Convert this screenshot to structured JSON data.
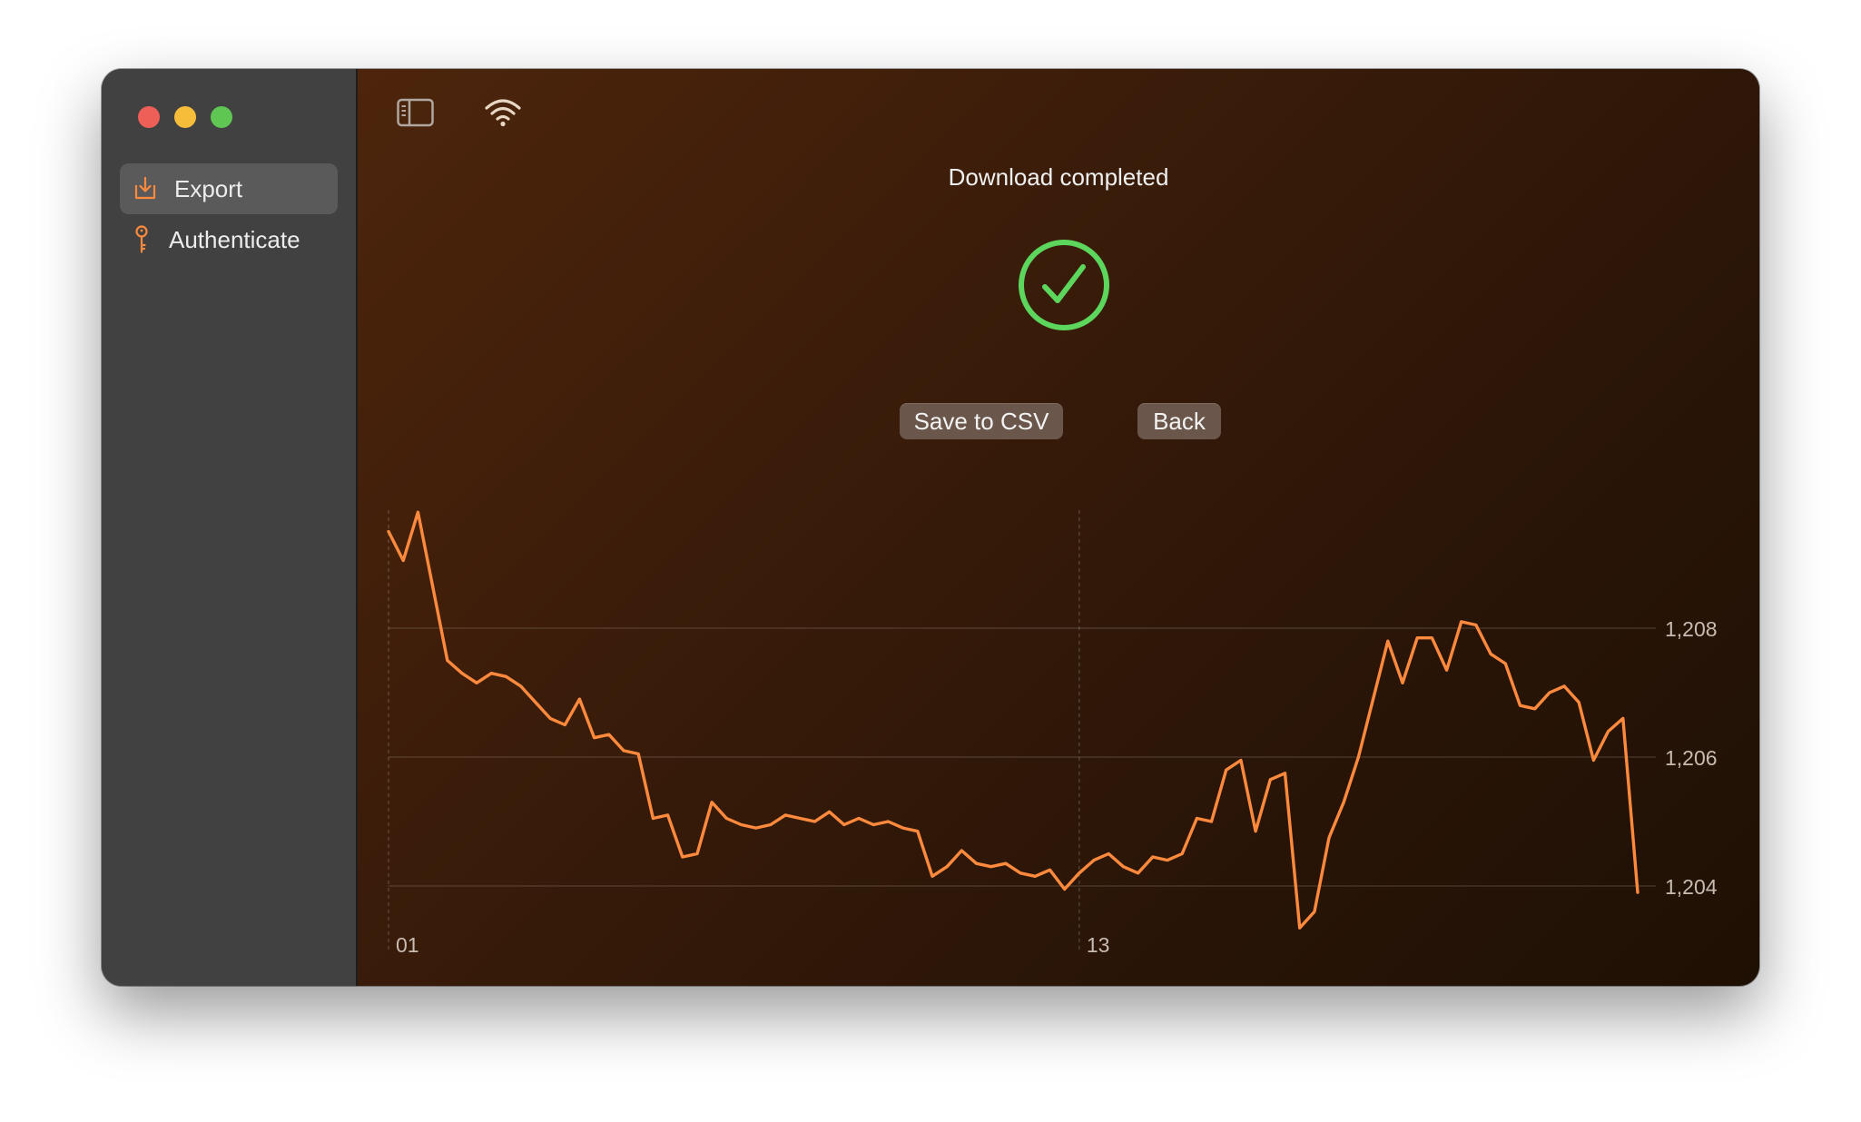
{
  "sidebar": {
    "items": [
      {
        "label": "Export",
        "icon": "download-tray-icon",
        "selected": true
      },
      {
        "label": "Authenticate",
        "icon": "key-icon",
        "selected": false
      }
    ]
  },
  "toolbar": {
    "icons": [
      "sidebar-toggle-icon",
      "wifi-icon"
    ]
  },
  "main": {
    "status": "Download completed",
    "status_icon": "checkmark-circle-icon",
    "status_color": "#5cd65c",
    "buttons": {
      "save_label": "Save to CSV",
      "back_label": "Back"
    }
  },
  "colors": {
    "accent": "#ff8a3d",
    "line": "#ff8a3d"
  },
  "chart_data": {
    "type": "line",
    "title": "",
    "xlabel": "",
    "ylabel": "",
    "x_tick_labels": [
      "01",
      "13",
      "01"
    ],
    "x_tick_index": [
      0,
      47,
      94
    ],
    "y_ticks": [
      1204,
      1206,
      1208
    ],
    "y_tick_labels": [
      "1,204",
      "1,206",
      "1,208"
    ],
    "ylim": [
      1203.0,
      1210.0
    ],
    "y_axis_position": "right",
    "grid": true,
    "series": [
      {
        "values": [
          1209.5,
          1209.05,
          1209.8,
          1208.65,
          1207.5,
          1207.3,
          1207.15,
          1207.3,
          1207.25,
          1207.1,
          1206.85,
          1206.6,
          1206.5,
          1206.9,
          1206.3,
          1206.35,
          1206.1,
          1206.05,
          1205.05,
          1205.1,
          1204.45,
          1204.5,
          1205.3,
          1205.05,
          1204.95,
          1204.9,
          1204.95,
          1205.1,
          1205.05,
          1205.0,
          1205.15,
          1204.95,
          1205.05,
          1204.95,
          1205.0,
          1204.9,
          1204.85,
          1204.15,
          1204.3,
          1204.55,
          1204.35,
          1204.3,
          1204.35,
          1204.2,
          1204.15,
          1204.25,
          1203.95,
          1204.2,
          1204.4,
          1204.5,
          1204.3,
          1204.2,
          1204.45,
          1204.4,
          1204.5,
          1205.05,
          1205.0,
          1205.8,
          1205.95,
          1204.85,
          1205.65,
          1205.75,
          1203.35,
          1203.6,
          1204.75,
          1205.3,
          1206.0,
          1206.9,
          1207.8,
          1207.15,
          1207.85,
          1207.85,
          1207.35,
          1208.1,
          1208.05,
          1207.6,
          1207.45,
          1206.8,
          1206.75,
          1207.0,
          1207.1,
          1206.85,
          1205.95,
          1206.4,
          1206.6,
          1203.9
        ]
      }
    ]
  }
}
